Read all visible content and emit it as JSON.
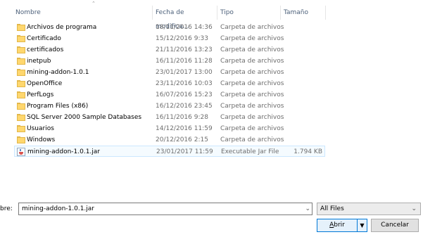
{
  "columns": {
    "name": "Nombre",
    "date": "Fecha de modifica...",
    "type": "Tipo",
    "size": "Tamaño"
  },
  "sort_icon": "chevron-up-icon",
  "files": [
    {
      "name": "Archivos de programa",
      "date": "18/11/2016 14:36",
      "type": "Carpeta de archivos",
      "size": "",
      "icon": "folder-icon"
    },
    {
      "name": "Certificado",
      "date": "15/12/2016 9:33",
      "type": "Carpeta de archivos",
      "size": "",
      "icon": "folder-icon"
    },
    {
      "name": "certificados",
      "date": "21/11/2016 13:23",
      "type": "Carpeta de archivos",
      "size": "",
      "icon": "folder-icon"
    },
    {
      "name": "inetpub",
      "date": "16/11/2016 11:28",
      "type": "Carpeta de archivos",
      "size": "",
      "icon": "folder-icon"
    },
    {
      "name": "mining-addon-1.0.1",
      "date": "23/01/2017 13:00",
      "type": "Carpeta de archivos",
      "size": "",
      "icon": "folder-icon"
    },
    {
      "name": "OpenOffice",
      "date": "23/11/2016 10:03",
      "type": "Carpeta de archivos",
      "size": "",
      "icon": "folder-icon"
    },
    {
      "name": "PerfLogs",
      "date": "16/07/2016 15:23",
      "type": "Carpeta de archivos",
      "size": "",
      "icon": "folder-icon"
    },
    {
      "name": "Program Files (x86)",
      "date": "16/12/2016 23:45",
      "type": "Carpeta de archivos",
      "size": "",
      "icon": "folder-icon"
    },
    {
      "name": "SQL Server 2000 Sample Databases",
      "date": "16/11/2016 9:28",
      "type": "Carpeta de archivos",
      "size": "",
      "icon": "folder-icon"
    },
    {
      "name": "Usuarios",
      "date": "14/12/2016 11:59",
      "type": "Carpeta de archivos",
      "size": "",
      "icon": "folder-icon"
    },
    {
      "name": "Windows",
      "date": "20/12/2016 2:15",
      "type": "Carpeta de archivos",
      "size": "",
      "icon": "folder-icon"
    },
    {
      "name": "mining-addon-1.0.1.jar",
      "date": "23/01/2017 11:59",
      "type": "Executable Jar File",
      "size": "1.794 KB",
      "icon": "jar-file-icon",
      "selected": true
    }
  ],
  "filename": {
    "label": "bre:",
    "value": "mining-addon-1.0.1.jar"
  },
  "filter": {
    "value": "All Files"
  },
  "buttons": {
    "open_accel": "A",
    "open_rest": "brir",
    "cancel": "Cancelar"
  },
  "colors": {
    "selection_border": "#cce8ff",
    "default_button_border": "#0078d7"
  }
}
